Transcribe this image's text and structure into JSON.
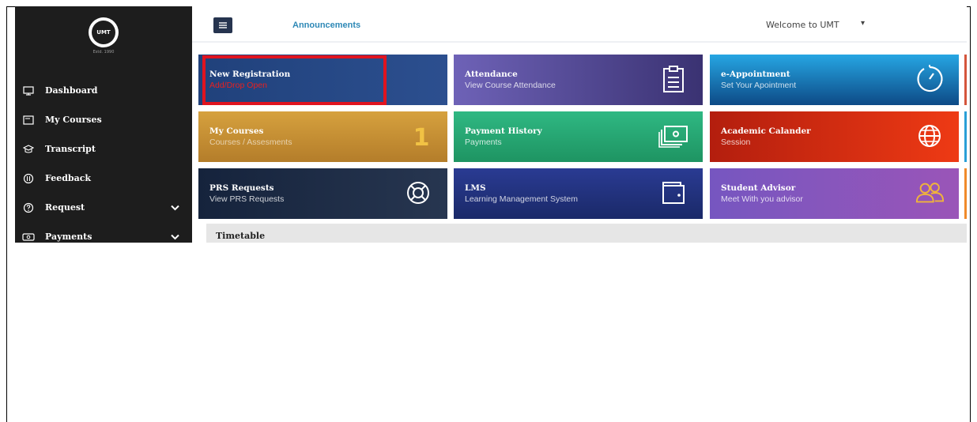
{
  "sidebar": {
    "logo_text": "UMT",
    "logo_est": "Estd. 1990",
    "items": [
      {
        "label": "Dashboard",
        "icon": "monitor-icon"
      },
      {
        "label": "My Courses",
        "icon": "book-icon"
      },
      {
        "label": "Transcript",
        "icon": "graduation-cap-icon"
      },
      {
        "label": "Feedback",
        "icon": "feedback-icon"
      },
      {
        "label": "Request",
        "icon": "question-icon",
        "expandable": true
      },
      {
        "label": "Payments",
        "icon": "payment-icon",
        "expandable": true
      }
    ]
  },
  "header": {
    "menu_icon": "hamburger-icon",
    "announcements": "Announcements",
    "welcome": "Welcome to UMT",
    "welcome_caret": "▾"
  },
  "tiles": [
    {
      "title": "New Registration",
      "subtitle": "Add/Drop Open",
      "icon": "none"
    },
    {
      "title": "Attendance",
      "subtitle": "View Course Attendance",
      "icon": "clipboard-icon"
    },
    {
      "title": "e-Appointment",
      "subtitle": "Set Your Apointment",
      "icon": "stopwatch-icon"
    },
    {
      "title": "My Courses",
      "subtitle": "Courses / Assesments",
      "icon": "count-badge",
      "count": "1"
    },
    {
      "title": "Payment History",
      "subtitle": "Payments",
      "icon": "money-icon"
    },
    {
      "title": "Academic Calander",
      "subtitle": "Session",
      "icon": "globe-icon"
    },
    {
      "title": "PRS Requests",
      "subtitle": "View PRS Requests",
      "icon": "lifebuoy-icon"
    },
    {
      "title": "LMS",
      "subtitle": "Learning Management System",
      "icon": "wallet-icon"
    },
    {
      "title": "Student Advisor",
      "subtitle": "Meet With you advisor",
      "icon": "users-icon"
    }
  ],
  "timetable": {
    "title": "Timetable"
  },
  "colors": {
    "sidebar_bg": "#1d1d1d",
    "highlight": "#e0141f",
    "link": "#2d88b6"
  }
}
